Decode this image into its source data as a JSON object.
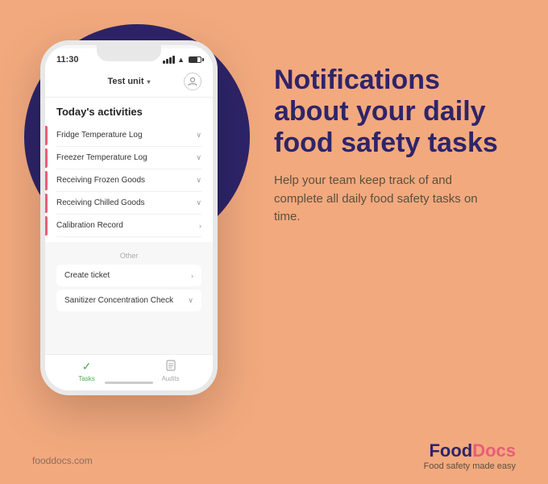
{
  "background": {
    "color": "#F2A97E"
  },
  "phone": {
    "status_time": "11:30",
    "unit_name": "Test unit",
    "activities_title": "Today's activities",
    "activity_items": [
      {
        "label": "Fridge Temperature Log",
        "icon": "chevron-down"
      },
      {
        "label": "Freezer Temperature Log",
        "icon": "chevron-down"
      },
      {
        "label": "Receiving Frozen Goods",
        "icon": "chevron-down"
      },
      {
        "label": "Receiving Chilled Goods",
        "icon": "chevron-down"
      },
      {
        "label": "Calibration Record",
        "icon": "chevron-right"
      }
    ],
    "other_label": "Other",
    "other_items": [
      {
        "label": "Create ticket",
        "icon": "chevron-right"
      },
      {
        "label": "Sanitizer Concentration Check",
        "icon": "chevron-down"
      }
    ],
    "nav": [
      {
        "label": "Tasks",
        "active": true,
        "icon": "✓"
      },
      {
        "label": "Audits",
        "active": false,
        "icon": "📋"
      }
    ]
  },
  "headline": {
    "line1": "Notifications",
    "line2": "about your daily",
    "line3": "food safety tasks"
  },
  "subtext": "Help your team keep track of and complete all daily food safety tasks on time.",
  "footer": {
    "website": "fooddocs.com",
    "brand": "FoodDocs",
    "tagline": "Food safety made easy"
  }
}
